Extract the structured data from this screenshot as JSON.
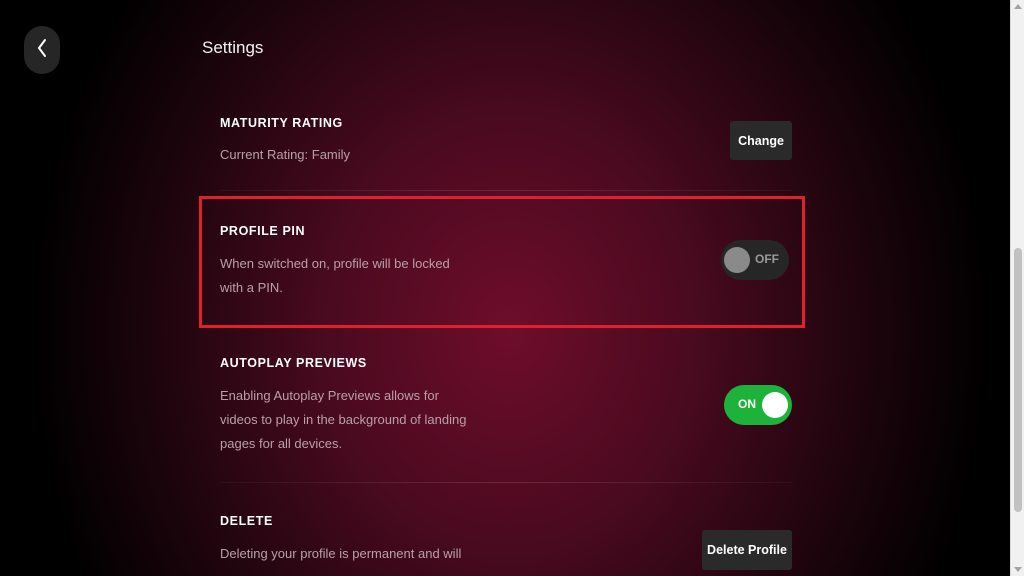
{
  "header": {
    "title": "Settings",
    "back_icon": "chevron-left-icon"
  },
  "sections": {
    "maturity": {
      "title": "MATURITY RATING",
      "description": "Current Rating: Family",
      "button_label": "Change"
    },
    "profile_pin": {
      "title": "PROFILE PIN",
      "description_line1": "When switched on, profile will be locked",
      "description_line2": "with a PIN.",
      "toggle_label": "OFF",
      "toggle_state": "off"
    },
    "autoplay": {
      "title": "AUTOPLAY PREVIEWS",
      "description_line1": "Enabling Autoplay Previews allows for",
      "description_line2": "videos to play in the background of landing",
      "description_line3": "pages for all devices.",
      "toggle_label": "ON",
      "toggle_state": "on"
    },
    "delete": {
      "title": "DELETE",
      "description_line1": "Deleting your profile is permanent and will",
      "button_label": "Delete Profile"
    }
  },
  "colors": {
    "highlight": "#e0202c",
    "toggle_on": "#1db33b",
    "toggle_off": "#262626",
    "background_center": "#6e0d2c"
  }
}
